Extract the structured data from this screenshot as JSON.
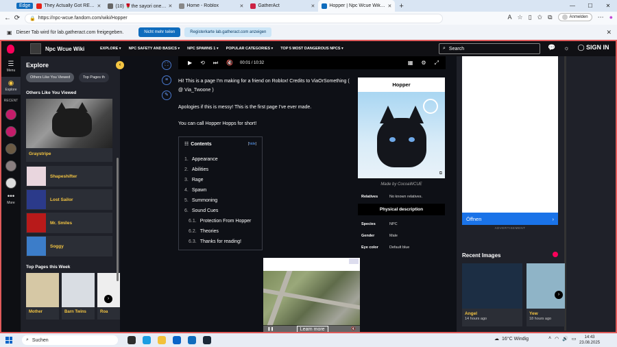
{
  "browser": {
    "edge_badge": "Edge",
    "tabs": [
      {
        "title": "They Actually Got REVEALE",
        "color": "#e62117"
      },
      {
        "title": "(10) 🌹the sayori one💔💔",
        "color": "#666"
      },
      {
        "title": "Home - Roblox",
        "color": "#888"
      },
      {
        "title": "GatherAct",
        "color": "#c24"
      },
      {
        "title": "Hopper | Npc Wcue Wiki | F",
        "color": "#0f6cbd",
        "active": true
      }
    ],
    "new_tab": "+",
    "url": "https://npc-wcue.fandom.com/wiki/Hopper",
    "signin_label": "Anmelden",
    "share_text": "Dieser Tab wird für lab.gatheract.com freigegeben.",
    "stop_share": "Nicht mehr teilen",
    "show_tab": "Registerkarte lab.gatheract.com anzeigen"
  },
  "fandom": {
    "wiki_name": "Npc Wcue Wiki",
    "nav": [
      "EXPLORE ▾",
      "NPC SAFETY AND BASICS ▾",
      "NPC SPAWNS 1 ▾",
      "POPULAR CATEGORIES ▾",
      "TOP 5 MOST DANGEROUS NPCS ▾"
    ],
    "search_placeholder": "Search",
    "sign_in": "SIGN IN"
  },
  "rail": {
    "menu": "Menu",
    "explore": "Explore",
    "recent": "RECENT",
    "more": "More"
  },
  "explore": {
    "title": "Explore",
    "chips": [
      "Others Like You Viewed",
      "Top Pages th"
    ],
    "section1": "Others Like You Viewed",
    "featured": "Graystripe",
    "items": [
      {
        "name": "Shapeshifter",
        "thumb": "#e9d6de"
      },
      {
        "name": "Lost Sailor",
        "thumb": "#2b3a8a"
      },
      {
        "name": "Mr. Smiles",
        "thumb": "#b81a1a"
      },
      {
        "name": "Soggy",
        "thumb": "#3c7dc9"
      }
    ],
    "section2": "Top Pages this Week",
    "top": [
      {
        "name": "Mother",
        "thumb": "#d6c8a5"
      },
      {
        "name": "Barn Twins",
        "thumb": "#d9dde3"
      },
      {
        "name": "Roa",
        "thumb": "#eee"
      }
    ]
  },
  "video": {
    "time": "00:01 / 10:32"
  },
  "article": {
    "p1": "Hi! This is a page I'm making for a friend on Roblox! Credits to ViaOrSomething ( @ Via_Twoone )",
    "p2": "Apologies if this is messy! This is the first page I've ever made.",
    "p3": "You can call Hopper Hopps for short!",
    "toc_title": "Contents",
    "toc_hide_open": "[",
    "toc_hide": "hide",
    "toc_hide_close": "]",
    "toc": [
      {
        "n": "1.",
        "t": "Appearance"
      },
      {
        "n": "2.",
        "t": "Abilities"
      },
      {
        "n": "3.",
        "t": "Rage"
      },
      {
        "n": "4.",
        "t": "Spawn"
      },
      {
        "n": "5.",
        "t": "Summoning"
      },
      {
        "n": "6.",
        "t": "Sound Cues"
      },
      {
        "n": "6.1.",
        "t": "Protection From Hopper",
        "sub": true
      },
      {
        "n": "6.2.",
        "t": "Theories",
        "sub": true
      },
      {
        "n": "6.3.",
        "t": "Thanks for reading!",
        "sub": true
      }
    ]
  },
  "infobox": {
    "title": "Hopper",
    "caption": "Made by CocoaWCUE",
    "relatives_k": "Relatives",
    "relatives_v": "No known relatives.",
    "section": "Physical description",
    "rows": [
      {
        "k": "Species",
        "v": "NPC"
      },
      {
        "k": "Gender",
        "v": "Male"
      },
      {
        "k": "Eye color",
        "v": "Default blue"
      }
    ]
  },
  "ad": {
    "learn_more": "Learn more",
    "open": "Öffnen",
    "advertisement": "ADVERTISEMENT"
  },
  "recent_images": {
    "title": "Recent Images",
    "items": [
      {
        "name": "Angel",
        "time": "14 hours ago",
        "color": "#1c2e44"
      },
      {
        "name": "Yew",
        "time": "18 hours ago",
        "color": "#8fb4c7"
      }
    ]
  },
  "taskbar": {
    "search": "Suchen",
    "weather": "16°C  Windig",
    "time": "14:43",
    "date": "23.08.2025"
  }
}
